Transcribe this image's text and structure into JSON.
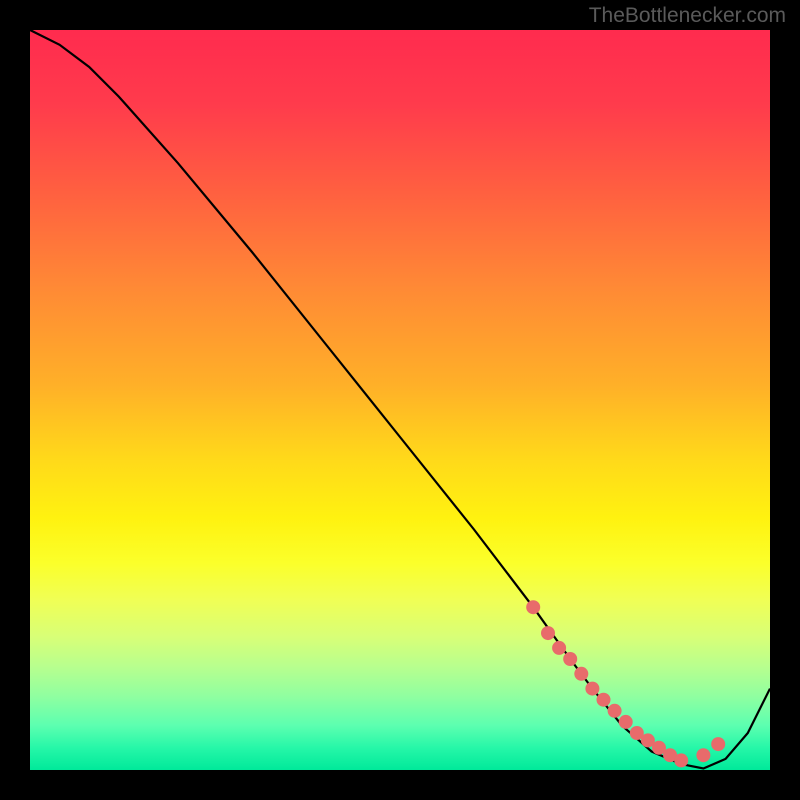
{
  "watermark": "TheBottlenecker.com",
  "chart_data": {
    "type": "line",
    "title": "",
    "xlabel": "",
    "ylabel": "",
    "xlim": [
      0,
      100
    ],
    "ylim": [
      0,
      100
    ],
    "series": [
      {
        "name": "curve",
        "x": [
          0,
          4,
          8,
          12,
          20,
          30,
          40,
          50,
          60,
          68,
          73,
          76,
          80,
          84,
          88,
          91,
          94,
          97,
          100
        ],
        "y": [
          100,
          98,
          95,
          91,
          82,
          70,
          57.5,
          45,
          32.5,
          22,
          15,
          11,
          6,
          2.5,
          0.8,
          0.2,
          1.5,
          5,
          11
        ]
      }
    ],
    "markers": {
      "name": "highlight-dots",
      "color": "#e86b6b",
      "x": [
        68,
        70,
        71.5,
        73,
        74.5,
        76,
        77.5,
        79,
        80.5,
        82,
        83.5,
        85,
        86.5,
        88,
        91,
        93
      ],
      "y": [
        22,
        18.5,
        16.5,
        15,
        13,
        11,
        9.5,
        8,
        6.5,
        5,
        4,
        3,
        2,
        1.3,
        2,
        3.5
      ]
    },
    "gradient_stops": [
      {
        "pos": 0,
        "color": "#ff2b4e"
      },
      {
        "pos": 50,
        "color": "#ffd000"
      },
      {
        "pos": 80,
        "color": "#f5ff40"
      },
      {
        "pos": 100,
        "color": "#00e99a"
      }
    ]
  }
}
